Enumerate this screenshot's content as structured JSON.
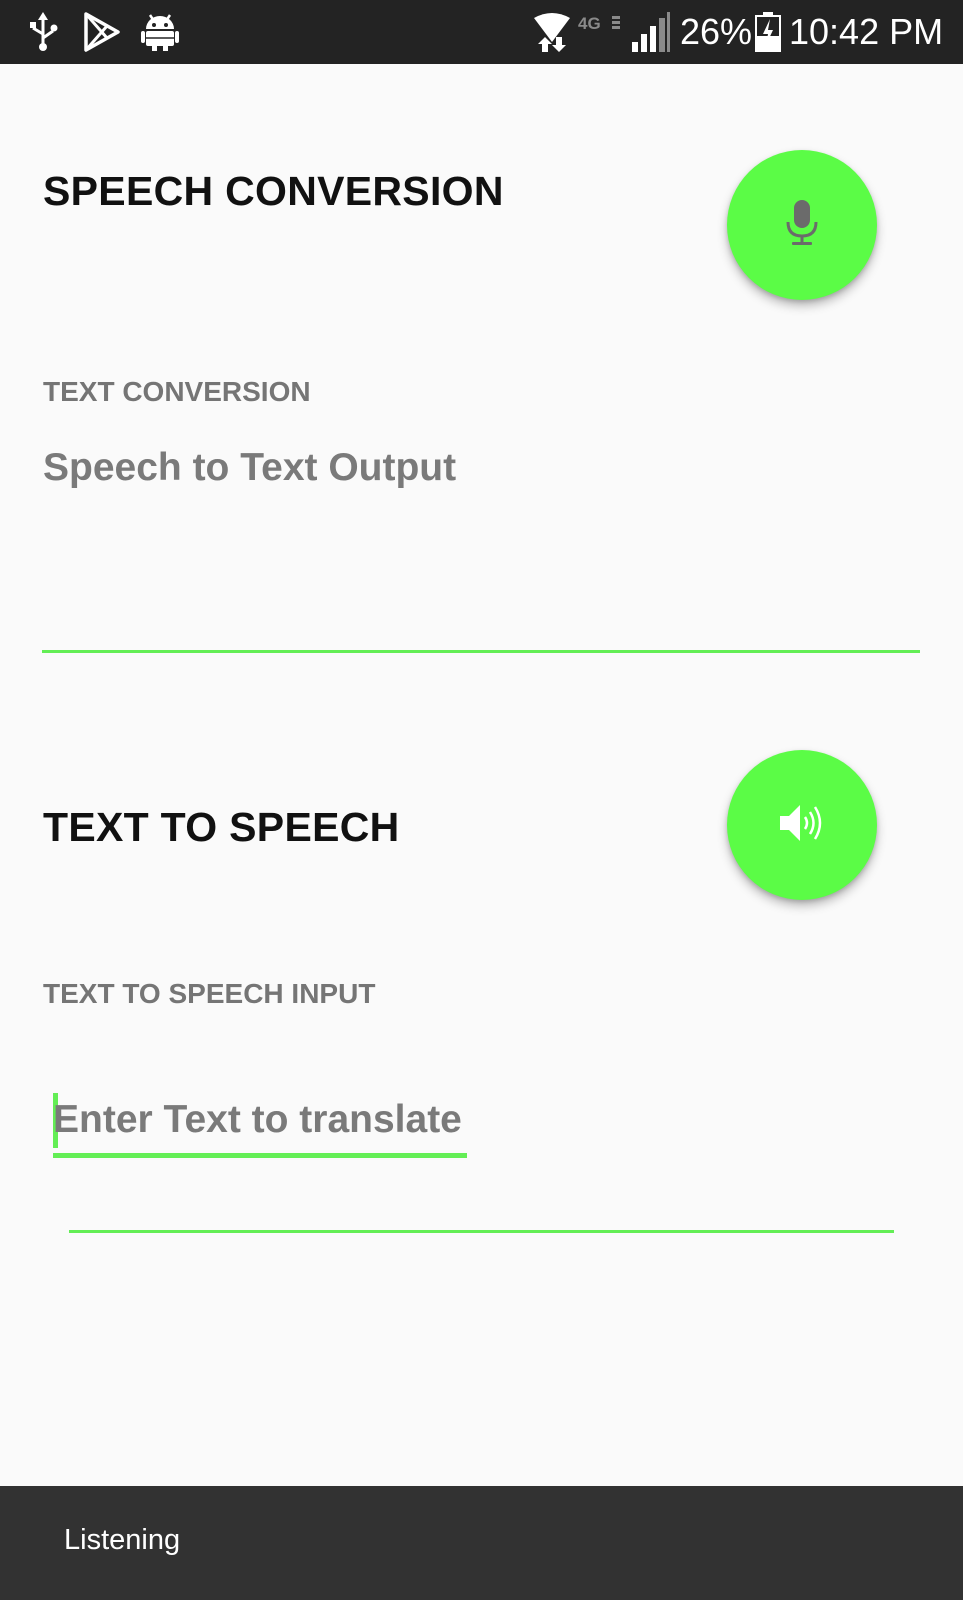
{
  "status_bar": {
    "battery": "26%",
    "time": "10:42 PM",
    "network_badge": "4G",
    "icons": [
      "usb-icon",
      "play-store-icon",
      "android-icon",
      "wifi-icon",
      "lte-icon",
      "signal-icon",
      "battery-icon"
    ]
  },
  "speech_section": {
    "title": "SPEECH CONVERSION",
    "label": "TEXT CONVERSION",
    "output_placeholder": "Speech to Text Output",
    "mic_icon": "microphone-icon"
  },
  "tts_section": {
    "title": "TEXT TO SPEECH",
    "label": "TEXT TO SPEECH INPUT",
    "input_placeholder": "Enter Text to translate",
    "speaker_icon": "speaker-icon"
  },
  "snackbar": {
    "message": "Listening"
  },
  "colors": {
    "accent": "#5bfc46",
    "status_bar": "#232323",
    "snackbar": "#323232",
    "background": "#fafafa"
  }
}
